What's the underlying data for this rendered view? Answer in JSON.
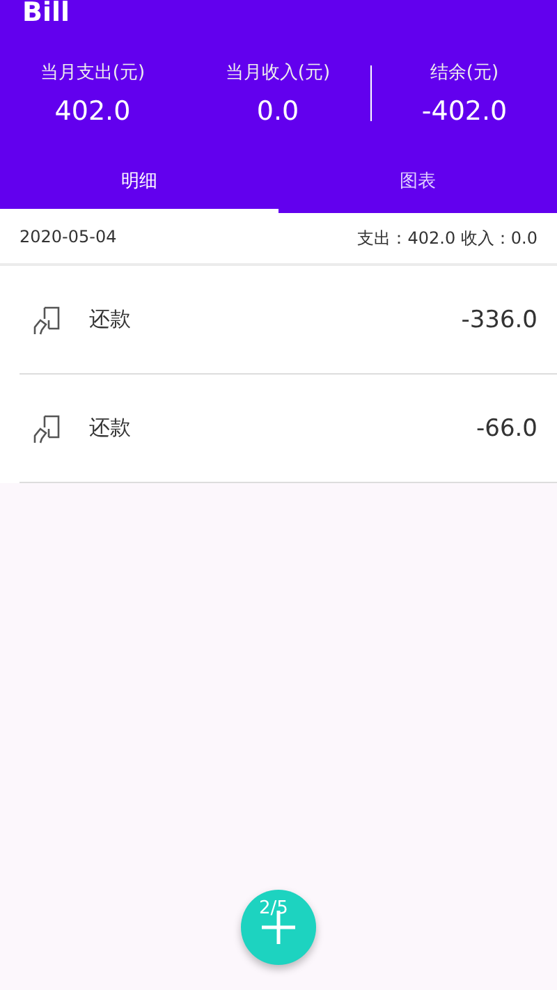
{
  "app_bar": {
    "title": "Bill"
  },
  "summary": [
    {
      "label": "当月支出(元)",
      "value": "402.0"
    },
    {
      "label": "当月收入(元)",
      "value": "0.0"
    },
    {
      "label": "结余(元)",
      "value": "-402.0"
    }
  ],
  "tabs": [
    {
      "label": "明细",
      "selected": true
    },
    {
      "label": "图表",
      "selected": false
    }
  ],
  "day": {
    "date": "2020-05-04",
    "totals": "支出：402.0 收入：0.0"
  },
  "entries": [
    {
      "category": "还款",
      "amount": "-336.0"
    },
    {
      "category": "还款",
      "amount": "-66.0"
    }
  ],
  "fab": {
    "page_indicator": "2/5"
  }
}
